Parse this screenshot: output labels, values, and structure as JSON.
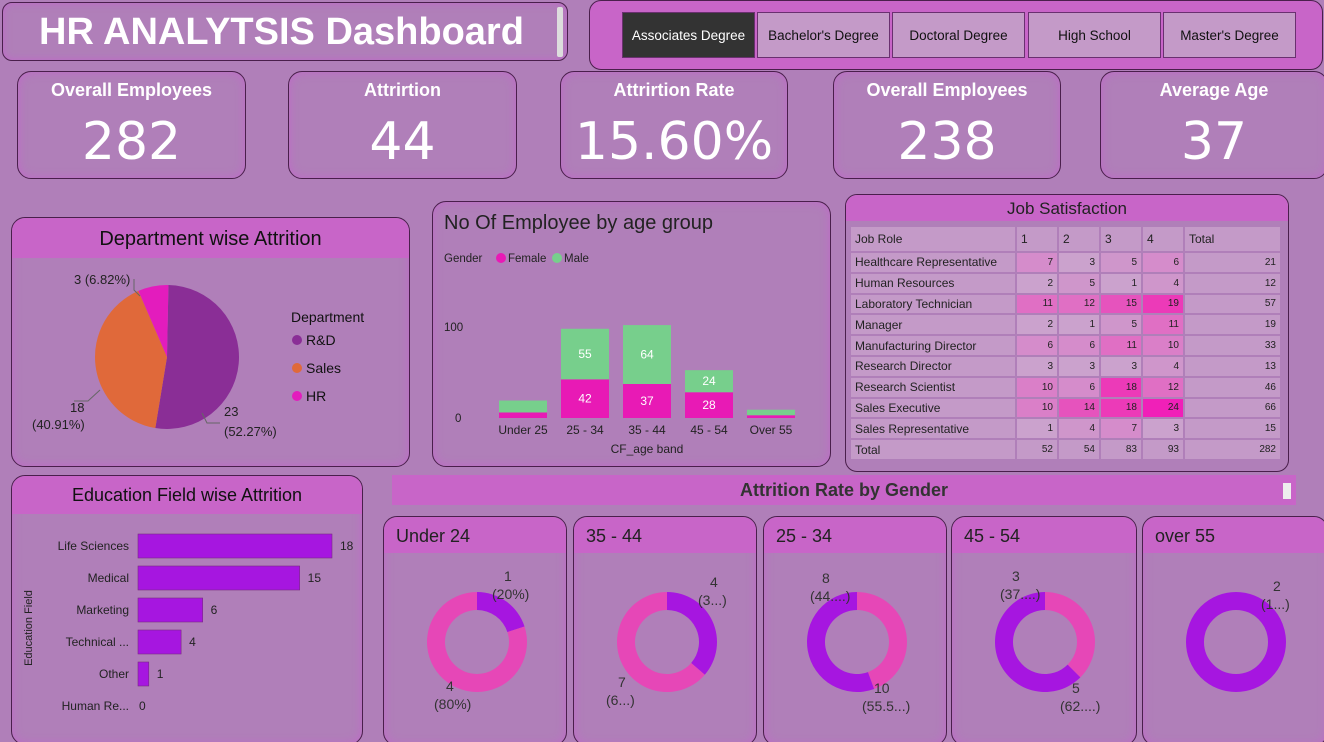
{
  "title": "HR ANALYTSIS Dashboard",
  "slicer": {
    "options": [
      "Associates Degree",
      "Bachelor's Degree",
      "Doctoral Degree",
      "High School",
      "Master's Degree"
    ],
    "selected": "Associates Degree"
  },
  "kpis": [
    {
      "label": "Overall Employees",
      "value": "282"
    },
    {
      "label": "Attrirtion",
      "value": "44"
    },
    {
      "label": "Attrirtion Rate",
      "value": "15.60%"
    },
    {
      "label": "Overall Employees",
      "value": "238"
    },
    {
      "label": "Average Age",
      "value": "37"
    }
  ],
  "colors": {
    "bg": "#b07fb9",
    "header": "#c865c8",
    "female": "#e81ab5",
    "male": "#77cf8c",
    "rd": "#8a2e96",
    "sales": "#e0693a",
    "hr": "#e31cbd",
    "bar": "#a616e0",
    "donut_a": "#a616e0",
    "donut_b": "#e647b7"
  },
  "chart_data": [
    {
      "type": "pie",
      "title": "Department wise Attrition",
      "legend_title": "Department",
      "legend_position": "right",
      "slices": [
        {
          "name": "R&D",
          "value": 23,
          "label": "23",
          "pct": "(52.27%)"
        },
        {
          "name": "Sales",
          "value": 18,
          "label": "18",
          "pct": "(40.91%)"
        },
        {
          "name": "HR",
          "value": 3,
          "label": "3 (6.82%)",
          "pct": ""
        }
      ]
    },
    {
      "type": "bar",
      "stacked": true,
      "title": "No Of Employee by age group",
      "legend_title": "Gender",
      "legend_position": "top-left",
      "xlabel": "CF_age band",
      "ylabel": "",
      "yticks": [
        "0",
        "100"
      ],
      "ylim": [
        0,
        110
      ],
      "categories": [
        "Under 25",
        "25 - 34",
        "35 - 44",
        "45 - 54",
        "Over 55"
      ],
      "series": [
        {
          "name": "Female",
          "values": [
            6,
            42,
            37,
            28,
            3
          ],
          "labels": [
            "",
            "42",
            "37",
            "28",
            ""
          ]
        },
        {
          "name": "Male",
          "values": [
            13,
            55,
            64,
            24,
            6
          ],
          "labels": [
            "",
            "55",
            "64",
            "24",
            ""
          ]
        }
      ]
    },
    {
      "type": "table",
      "title": "Job Satisfaction",
      "columns": [
        "Job Role",
        "1",
        "2",
        "3",
        "4",
        "Total"
      ],
      "rows": [
        [
          "Healthcare Representative",
          "7",
          "3",
          "5",
          "6",
          "21"
        ],
        [
          "Human Resources",
          "2",
          "5",
          "1",
          "4",
          "12"
        ],
        [
          "Laboratory Technician",
          "11",
          "12",
          "15",
          "19",
          "57"
        ],
        [
          "Manager",
          "2",
          "1",
          "5",
          "11",
          "19"
        ],
        [
          "Manufacturing Director",
          "6",
          "6",
          "11",
          "10",
          "33"
        ],
        [
          "Research Director",
          "3",
          "3",
          "3",
          "4",
          "13"
        ],
        [
          "Research Scientist",
          "10",
          "6",
          "18",
          "12",
          "46"
        ],
        [
          "Sales Executive",
          "10",
          "14",
          "18",
          "24",
          "66"
        ],
        [
          "Sales Representative",
          "1",
          "4",
          "7",
          "3",
          "15"
        ],
        [
          "Total",
          "52",
          "54",
          "83",
          "93",
          "282"
        ]
      ]
    },
    {
      "type": "bar",
      "orientation": "horizontal",
      "title": "Education Field wise Attrition",
      "ylabel": "Education Field",
      "categories": [
        "Life Sciences",
        "Medical",
        "Marketing",
        "Technical ...",
        "Other",
        "Human Re..."
      ],
      "values": [
        18,
        15,
        6,
        4,
        1,
        0
      ],
      "xlim": [
        0,
        18
      ]
    },
    {
      "type": "pie",
      "donut": true,
      "title": "Attrition Rate by Gender",
      "charts": [
        {
          "title": "Under 24",
          "segments": [
            {
              "value": 1,
              "label": "1",
              "pct": "(20%)"
            },
            {
              "value": 4,
              "label": "4",
              "pct": "(80%)"
            }
          ]
        },
        {
          "title": "35 - 44",
          "segments": [
            {
              "value": 4,
              "label": "4",
              "pct": "(3...)"
            },
            {
              "value": 7,
              "label": "7",
              "pct": "(6...)"
            }
          ]
        },
        {
          "title": "25 - 34",
          "segments": [
            {
              "value": 8,
              "label": "8",
              "pct": "(44....)"
            },
            {
              "value": 10,
              "label": "10",
              "pct": "(55.5...)"
            }
          ]
        },
        {
          "title": "45 - 54",
          "segments": [
            {
              "value": 3,
              "label": "3",
              "pct": "(37....)"
            },
            {
              "value": 5,
              "label": "5",
              "pct": "(62....)"
            }
          ]
        },
        {
          "title": "over 55",
          "segments": [
            {
              "value": 2,
              "label": "2",
              "pct": "(1...)"
            }
          ]
        }
      ]
    }
  ]
}
